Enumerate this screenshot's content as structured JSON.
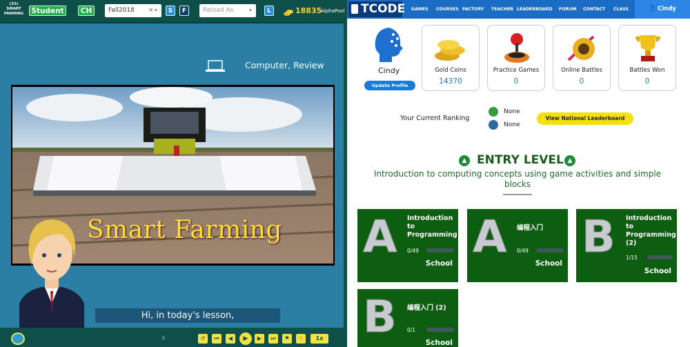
{
  "left_panel": {
    "lesson_badge": "(33)",
    "lesson_badge_sub1": "SMART",
    "lesson_badge_sub2": "FARMING",
    "student_label": "Student",
    "ch_label": "CH",
    "term_value": "Fall2018",
    "term_clear": "×",
    "s_label": "S",
    "f_label": "F",
    "reload_placeholder": "Reload As",
    "l_label": "L",
    "coins": "18835",
    "pool_label": "AlphaPool",
    "device_label": "Computer, Review",
    "video_title": "Smart Farming",
    "caption": "Hi, in today's lesson,",
    "speed": "1x"
  },
  "nav": {
    "brand": "TCODE",
    "items": [
      "GAMES",
      "COURSES",
      "FACTORY",
      "TEACHER",
      "LEADERBOARD",
      "FORUM",
      "CONTACT",
      "CLASS"
    ],
    "user": "Cindy"
  },
  "profile": {
    "name": "Cindy",
    "update_button": "Update Profile"
  },
  "stats": [
    {
      "label": "Gold Coins",
      "value": "14370",
      "icon": "gold-coins-icon"
    },
    {
      "label": "Practice Games",
      "value": "0",
      "icon": "joystick-icon"
    },
    {
      "label": "Online Battles",
      "value": "0",
      "icon": "battle-shield-icon"
    },
    {
      "label": "Battles Won",
      "value": "0",
      "icon": "trophy-icon"
    }
  ],
  "ranking": {
    "label": "Your Current Ranking",
    "local": "None",
    "world": "None",
    "button": "View National Leaderboard"
  },
  "level": {
    "title": "ENTRY LEVEL",
    "subtitle": "Introduction to computing concepts using game activities and simple blocks"
  },
  "courses": [
    {
      "letter": "A",
      "title": "Introduction to Programming",
      "progress": "0/49",
      "fraction": 0,
      "school": "School"
    },
    {
      "letter": "A",
      "title": "编程入门",
      "progress": "0/49",
      "fraction": 0,
      "school": "School"
    },
    {
      "letter": "B",
      "title": "Introduction to Programming (2)",
      "progress": "1/15",
      "fraction": 0.07,
      "school": "School"
    },
    {
      "letter": "B",
      "title": "编程入门 (2)",
      "progress": "0/1",
      "fraction": 0,
      "school": "School"
    }
  ],
  "colors": {
    "nav_blue": "#1a6cc4",
    "course_green": "#0e5e12",
    "accent_green": "#1fb24a",
    "yellow": "#f5e142"
  }
}
